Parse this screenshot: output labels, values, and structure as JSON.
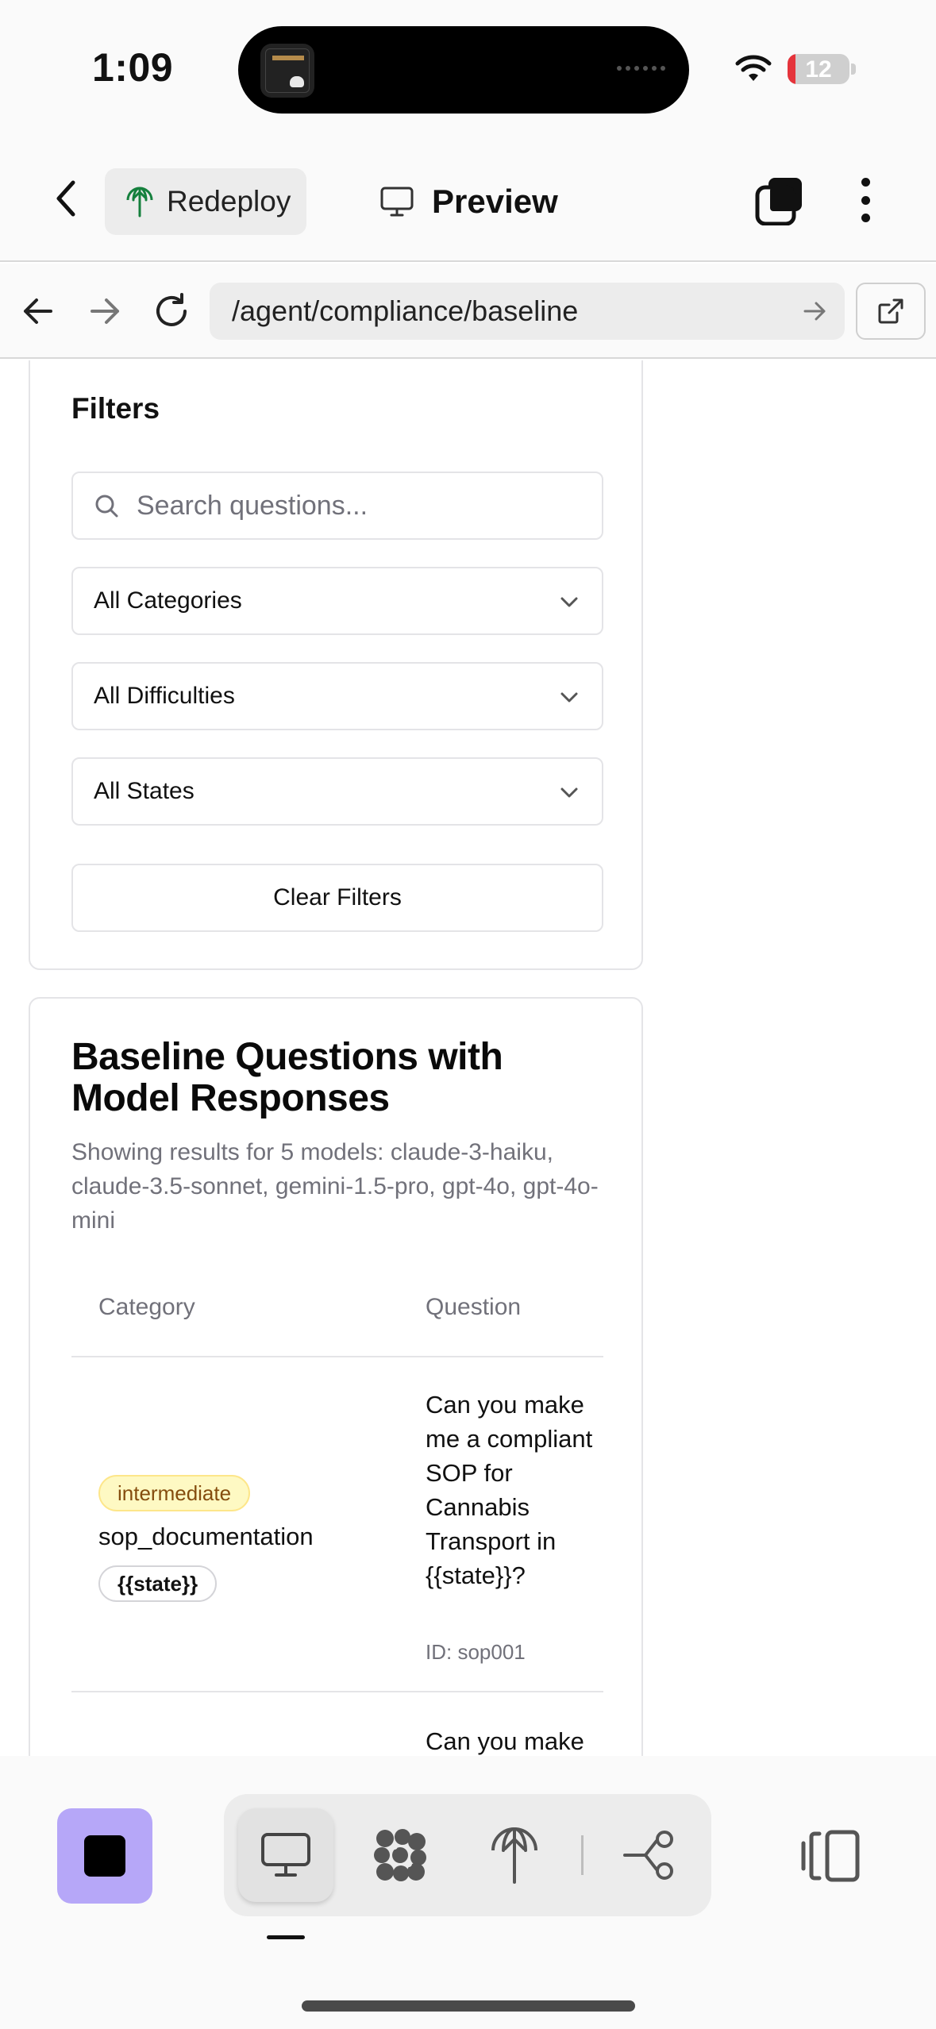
{
  "status_bar": {
    "time": "1:09",
    "battery_level": "12",
    "battery_color": "#e5343b"
  },
  "app_header": {
    "back_icon": "chevron-left-icon",
    "redeploy_label": "Redeploy",
    "redeploy_icon": "antenna-icon",
    "preview_label": "Preview",
    "preview_icon": "monitor-icon",
    "tabs_icon": "stacked-squares-icon",
    "more_icon": "vertical-dots-icon"
  },
  "browser": {
    "url": "/agent/compliance/baseline",
    "back_icon": "arrow-left-icon",
    "forward_icon": "arrow-right-icon",
    "reload_icon": "reload-icon",
    "go_icon": "arrow-right-icon",
    "external_icon": "external-link-icon"
  },
  "filters": {
    "title": "Filters",
    "search_placeholder": "Search questions...",
    "category_select": "All Categories",
    "difficulty_select": "All Difficulties",
    "state_select": "All States",
    "clear_label": "Clear Filters"
  },
  "questions": {
    "title": "Baseline Questions with Model Responses",
    "description": "Showing results for 5 models: claude-3-haiku, claude-3.5-sonnet, gemini-1.5-pro, gpt-4o, gpt-4o-mini",
    "columns": [
      "Category",
      "Question"
    ],
    "rows": [
      {
        "difficulty": "intermediate",
        "category": "sop_documentation",
        "state": "{{state}}",
        "question": "Can you make me a compliant SOP for Cannabis Transport in {{state}}?",
        "id": "ID: sop001"
      },
      {
        "question": "Can you make"
      }
    ]
  },
  "bottom_bar": {
    "stop_color": "#b6a7f8",
    "items": [
      {
        "icon": "monitor-icon",
        "active": true
      },
      {
        "icon": "dots-grid-icon",
        "active": false
      },
      {
        "icon": "antenna-icon",
        "active": false
      },
      {
        "icon": "workflow-icon",
        "active": false
      }
    ],
    "split_icon": "split-view-icon"
  }
}
